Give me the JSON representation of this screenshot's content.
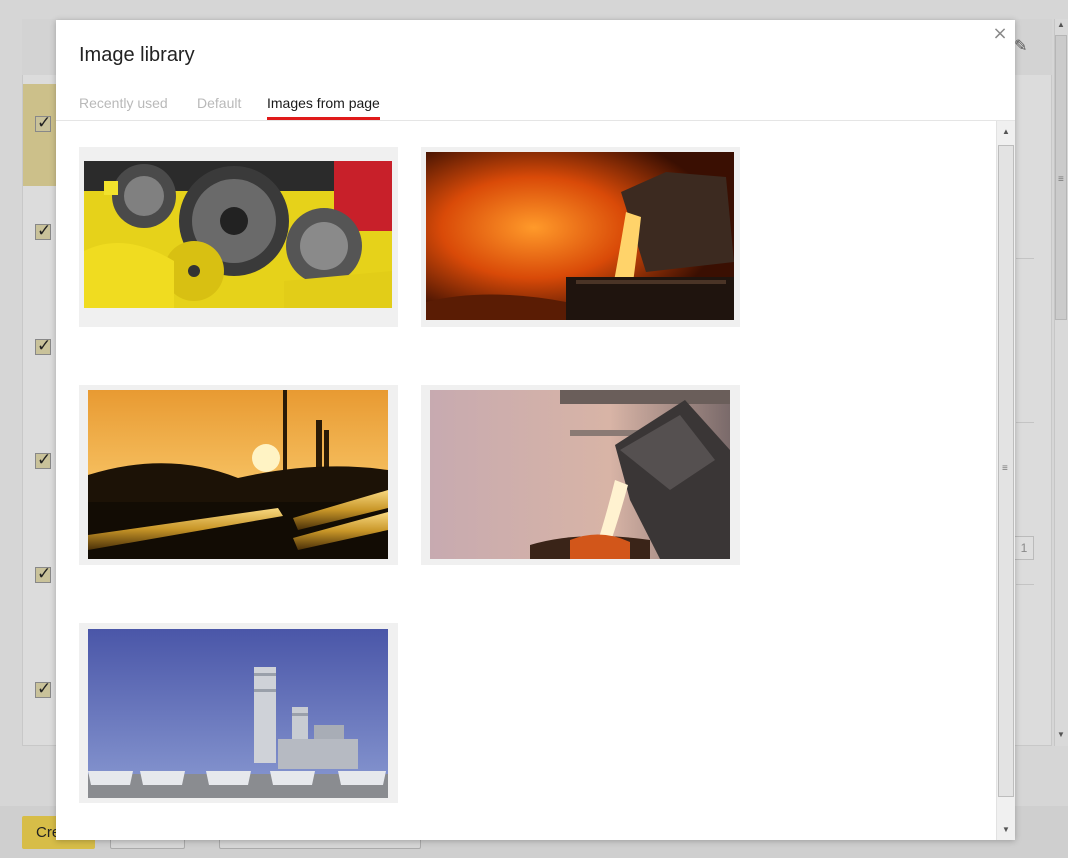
{
  "dialog": {
    "title": "Image library",
    "close_glyph": "×",
    "tabs": [
      {
        "label": "Recently used",
        "active": false
      },
      {
        "label": "Default",
        "active": false
      },
      {
        "label": "Images from page",
        "active": true
      }
    ],
    "accent_color": "#e01a1a",
    "images": [
      {
        "name": "yellow-gears-image"
      },
      {
        "name": "molten-steel-pour-image"
      },
      {
        "name": "pipeline-sunset-image"
      },
      {
        "name": "steel-ladle-steam-image"
      },
      {
        "name": "power-plant-blue-sky-image"
      }
    ]
  },
  "background": {
    "create_button_label": "Cre",
    "number_field_value": "1",
    "pencil_icon": "pencil-icon"
  }
}
